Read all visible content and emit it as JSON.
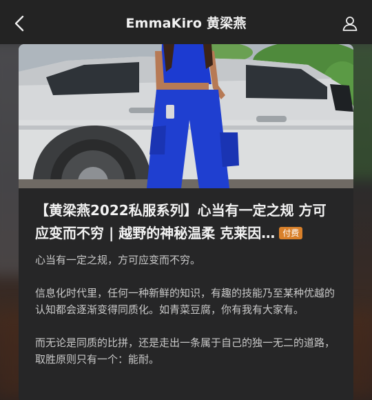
{
  "header": {
    "title": "EmmaKiro 黄梁燕",
    "back_icon": "chevron-left-icon",
    "user_icon": "user-icon"
  },
  "post": {
    "title": "【黄梁燕2022私服系列】心当有一定之规 方可应变而不穷 | 越野的神秘温柔 克莱因…",
    "badge": "付费",
    "badge_color": "#d9802a",
    "paragraphs": [
      "心当有一定之规，方可应变而不穷。",
      "信息化时代里，任何一种新鲜的知识，有趣的技能乃至某种优越的认知都会逐渐变得同质化。如青菜豆腐，你有我有大家有。",
      "而无论是同质的比拼，还是走出一条属于自己的独一无二的道路，取胜原则只有一个：能耐。"
    ]
  },
  "colors": {
    "topbar_bg": "#232323",
    "card_bg": "#262627",
    "outfit_blue": "#1f3fd0"
  }
}
